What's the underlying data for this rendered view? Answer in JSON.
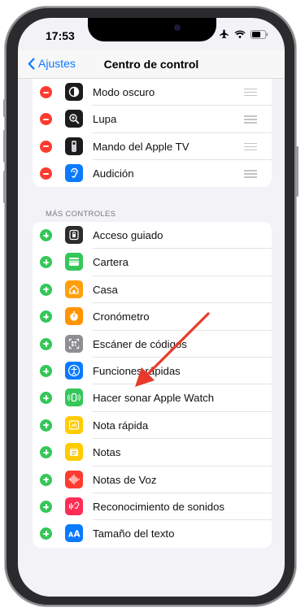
{
  "status": {
    "time": "17:53"
  },
  "nav": {
    "back_label": "Ajustes",
    "title": "Centro de control"
  },
  "included": [
    {
      "label": "Modo oscuro",
      "icon": "dark-mode-icon",
      "color": "#1c1c1e"
    },
    {
      "label": "Lupa",
      "icon": "magnifier-icon",
      "color": "#1c1c1e"
    },
    {
      "label": "Mando del Apple TV",
      "icon": "apple-tv-remote-icon",
      "color": "#1c1c1e"
    },
    {
      "label": "Audición",
      "icon": "ear-icon",
      "color": "#0a7aff"
    }
  ],
  "more_header": "MÁS CONTROLES",
  "more": [
    {
      "label": "Acceso guiado",
      "icon": "lock-icon",
      "color": "#2c2c2e"
    },
    {
      "label": "Cartera",
      "icon": "wallet-icon",
      "color": "#34c759"
    },
    {
      "label": "Casa",
      "icon": "home-icon",
      "color": "#ff9f0a"
    },
    {
      "label": "Cronómetro",
      "icon": "stopwatch-icon",
      "color": "#ff9500"
    },
    {
      "label": "Escáner de códigos",
      "icon": "qr-scanner-icon",
      "color": "#8e8e93"
    },
    {
      "label": "Funciones rápidas",
      "icon": "accessibility-icon",
      "color": "#0a7aff"
    },
    {
      "label": "Hacer sonar Apple Watch",
      "icon": "ping-watch-icon",
      "color": "#34c759"
    },
    {
      "label": "Nota rápida",
      "icon": "quick-note-icon",
      "color": "#ffcc00"
    },
    {
      "label": "Notas",
      "icon": "notes-icon",
      "color": "#ffcc00"
    },
    {
      "label": "Notas de Voz",
      "icon": "voice-memos-icon",
      "color": "#ff3b30"
    },
    {
      "label": "Reconocimiento de sonidos",
      "icon": "sound-recognition-icon",
      "color": "#ff2d55"
    },
    {
      "label": "Tamaño del texto",
      "icon": "text-size-icon",
      "color": "#0a7aff"
    }
  ],
  "colors": {
    "accent": "#0a7aff",
    "remove": "#ff3b30",
    "add": "#34c759",
    "annotation_arrow": "#e8392a"
  }
}
